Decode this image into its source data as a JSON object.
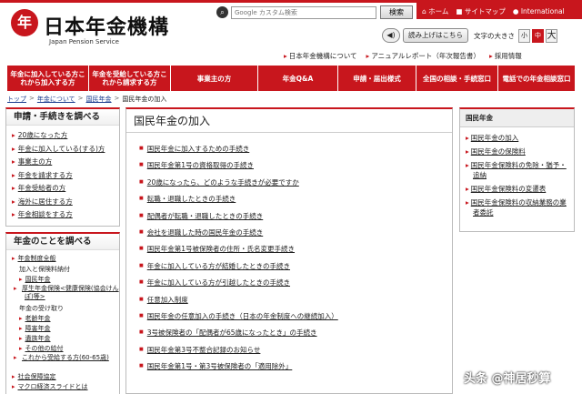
{
  "header": {
    "brand_seal": "年",
    "brand": "日本年金機構",
    "brand_en": "Japan Pension Service"
  },
  "search": {
    "placeholder": "Google カスタム検索",
    "button": "検索"
  },
  "toplinks": [
    "⌂ ホーム",
    "■ サイトマップ",
    "● International"
  ],
  "tools": {
    "read_aloud": "読み上げはこちら",
    "font_size_label": "文字の大きさ",
    "small": "小",
    "medium": "中",
    "large": "大"
  },
  "sublinks": [
    "日本年金機構について",
    "アニュアルレポート（年次報告書）",
    "採用情報"
  ],
  "nav": [
    "年金に加入している方これから加入する方",
    "年金を受給している方これから請求する方",
    "事業主の方",
    "年金Q&A",
    "申請・届出様式",
    "全国の相談・手続窓口",
    "電話での年金相談窓口"
  ],
  "breadcrumb": [
    "トップ",
    "年金について",
    "国民年金",
    "国民年金の加入"
  ],
  "sidebar": {
    "box1_title": "申請・手続きを調べる",
    "box1_items": [
      "20歳になった方",
      "年金に加入している(する)方",
      "事業主の方",
      "年金を請求する方",
      "年金受給者の方",
      "海外に居住する方",
      "年金相談をする方"
    ],
    "box2_title": "年金のことを調べる",
    "box2_top": "年金制度全般",
    "box2_sub1_label": "加入と保険料納付",
    "box2_sub1_items": [
      "国民年金",
      "厚生年金保険<健康保険(協会けんぽ)等>"
    ],
    "box2_sub2_label": "年金の受け取り",
    "box2_sub2_items": [
      "老齢年金",
      "障害年金",
      "遺族年金",
      "その他の給付",
      "これから受給する方(60-65歳)"
    ],
    "box2_more": [
      "社会保障協定",
      "マクロ経済スライドとは"
    ]
  },
  "main": {
    "title": "国民年金の加入",
    "items": [
      "国民年金に加入するための手続き",
      "国民年金第1号の資格取得の手続き",
      "20歳になったら、どのような手続きが必要ですか",
      "転職・退職したときの手続き",
      "配偶者が転職・退職したときの手続き",
      "会社を退職した時の国民年金の手続き",
      "国民年金第1号被保険者の住所・氏名変更手続き",
      "年金に加入している方が結婚したときの手続き",
      "年金に加入している方が引越したときの手続き",
      "任意加入制度",
      "国民年金の任意加入の手続き（日本の年金制度への継続加入）",
      "3号被保険者の「配偶者が65歳になったとき」の手続き",
      "国民年金第3号不整合記録のお知らせ",
      "国民年金第1号・第3号被保険者の「適用除外」"
    ]
  },
  "right": {
    "title": "国民年金",
    "items": [
      "国民年金の加入",
      "国民年金の保険料",
      "国民年金保険料の免除・猶予・追納",
      "国民年金保険料の変遷表",
      "国民年金保険料の収納業務の業者委託"
    ]
  },
  "watermark": "头条 @神居秒算"
}
